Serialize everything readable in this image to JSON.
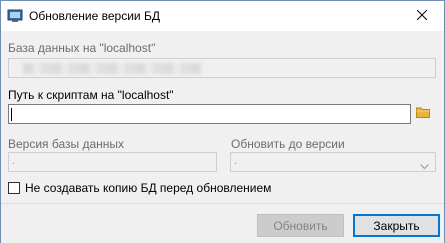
{
  "window": {
    "title": "Обновление версии БД"
  },
  "db": {
    "label": "База данных на \"localhost\"",
    "value": ""
  },
  "scripts": {
    "label": "Путь к скриптам на \"localhost\"",
    "value": ""
  },
  "version": {
    "label": "Версия базы данных",
    "value": "."
  },
  "upgrade": {
    "label": "Обновить до версии",
    "selected": "."
  },
  "nobackup": {
    "label": "Не создавать копию БД перед обновлением",
    "checked": false
  },
  "buttons": {
    "update": "Обновить",
    "close": "Закрыть"
  },
  "colors": {
    "accent": "#0078d7",
    "window_bg": "#f0f0f0",
    "folder": "#e8b53c"
  },
  "icons": {
    "app": "database-app-icon",
    "close": "close-icon",
    "folder": "folder-icon",
    "dropdown": "chevron-down-icon"
  }
}
